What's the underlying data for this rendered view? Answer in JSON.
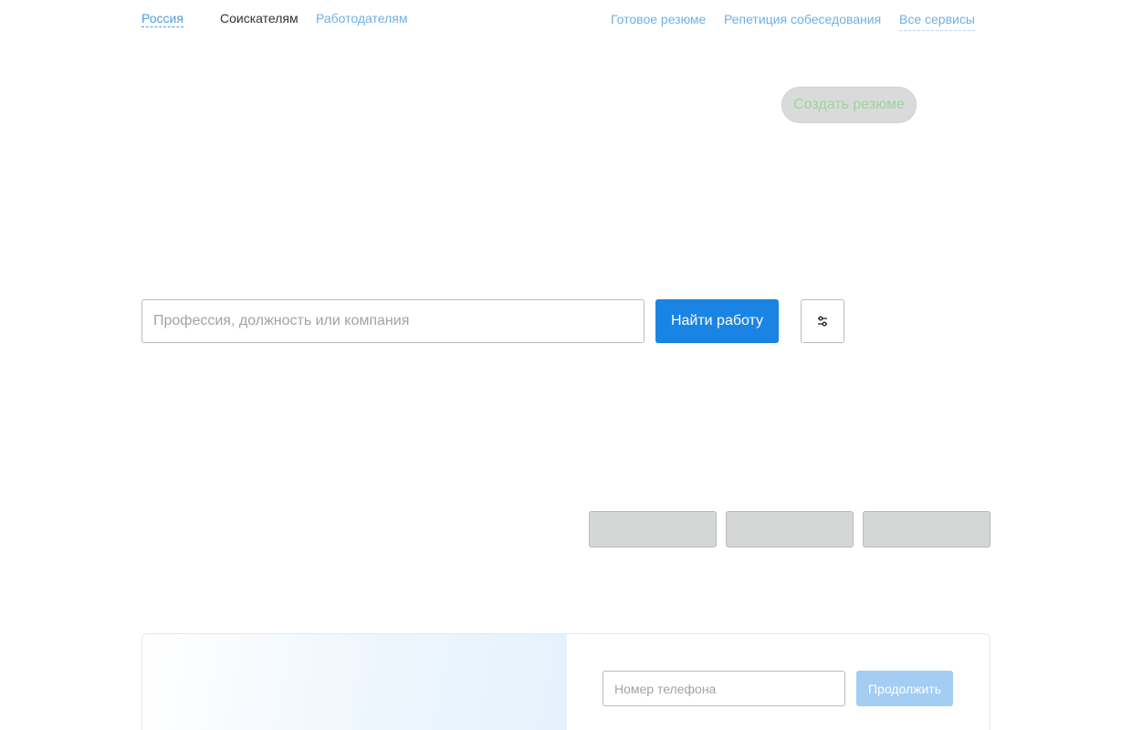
{
  "header": {
    "region": "Россия",
    "nav_seekers": "Соискателям",
    "nav_employers": "Работодателям",
    "nav_ready_resume": "Готовое резюме",
    "nav_interview": "Репетиция собеседования",
    "nav_all_services": "Все сервисы"
  },
  "hero": {
    "create_resume": "Создать резюме"
  },
  "search": {
    "placeholder": "Профессия, должность или компания",
    "button": "Найти работу",
    "filters_icon": "sliders-icon"
  },
  "login": {
    "phone_placeholder": "Номер телефона",
    "continue": "Продолжить"
  },
  "colors": {
    "accent": "#1a84e4",
    "link": "#6fb0e4",
    "disabled_button": "#a3cdf2"
  }
}
